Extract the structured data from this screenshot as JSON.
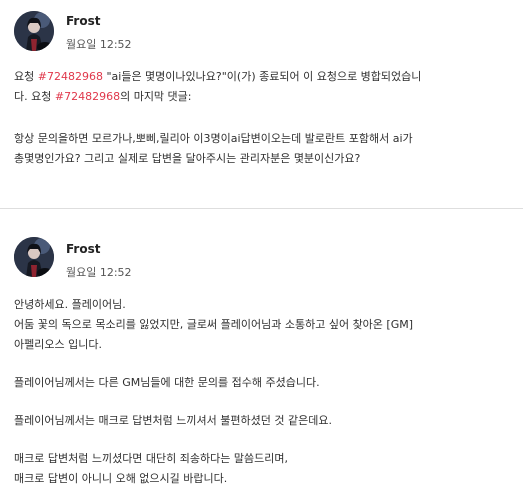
{
  "comments": [
    {
      "author": "Frost",
      "timestamp": "월요일 12:52",
      "merge_notice": {
        "prefix": "요청 ",
        "ref1": "#72482968",
        "middle": " \"ai들은 몇명이나있나요?\"이(가) 종료되어 이 요청으로 병합되었습니",
        "line2_start": "다. 요청 ",
        "ref2": "#72482968",
        "line2_end": "의 마지막 댓글:"
      },
      "quote_lines": [
        "항상 문의을하면 모르가나,뽀삐,릴리아 이3명이ai답변이오는데 발로란트 포함해서 ai가",
        "총몇명인가요? 그리고 실제로 답변을 달아주시는 관리자분은 몇분이신가요?"
      ]
    },
    {
      "author": "Frost",
      "timestamp": "월요일 12:52",
      "lines": [
        "안녕하세요. 플레이어님.",
        "어둠 꽃의 독으로 목소리를 잃었지만, 글로써 플레이어님과 소통하고 싶어 찾아온 [GM]",
        "아펠리오스 입니다.",
        "",
        "플레이어님께서는 다른 GM님들에 대한 문의를 접수해 주셨습니다.",
        "",
        "플레이어님께서는 매크로 답변처럼 느끼셔서 불편하셨던 것 같은데요.",
        "",
        "매크로 답변처럼 느끼셨다면 대단히 죄송하다는 말씀드리며,",
        "매크로 답변이 아니니 오해 없으시길 바랍니다."
      ]
    }
  ],
  "colors": {
    "link": "#e0384b",
    "divider": "#dedede",
    "text": "#2f2f2f"
  }
}
